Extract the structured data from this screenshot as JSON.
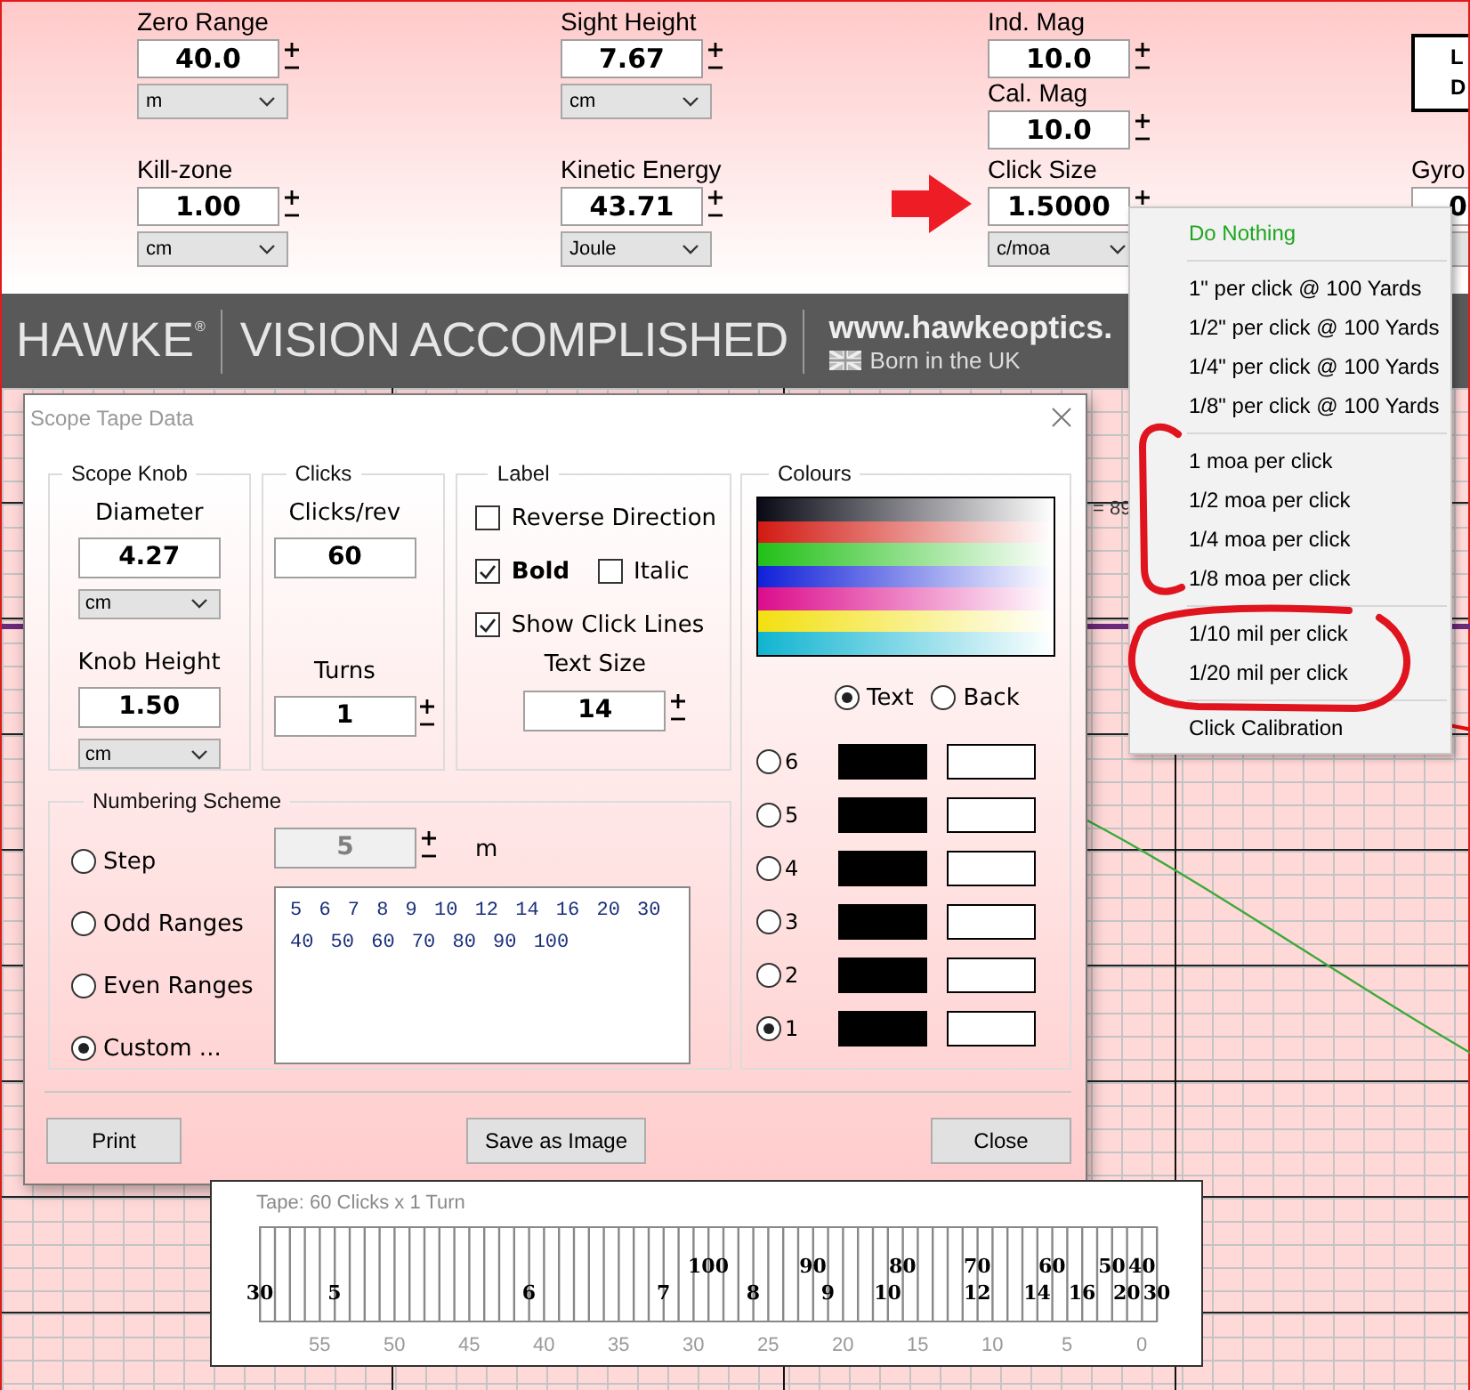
{
  "top_panel": {
    "columns": [
      {
        "fields": [
          {
            "label": "Zero Range",
            "value": "40.0",
            "unit": "m"
          },
          {
            "label": "Kill-zone",
            "value": "1.00",
            "unit": "cm"
          }
        ]
      },
      {
        "fields": [
          {
            "label": "Sight Height",
            "value": "7.67",
            "unit": "cm"
          },
          {
            "label": "Kinetic Energy",
            "value": "43.71",
            "unit": "Joule"
          }
        ]
      },
      {
        "fields": [
          {
            "label": "Ind. Mag",
            "value": "10.0"
          },
          {
            "label": "Cal. Mag",
            "value": "10.0"
          },
          {
            "label": "Click Size",
            "value": "1.5000",
            "unit": "c/moa"
          }
        ]
      }
    ],
    "edge_box": {
      "lines": [
        "L",
        "D"
      ]
    },
    "edge_field": {
      "label": "Gyro",
      "value": "0"
    }
  },
  "banner": {
    "logo": "HAWKE",
    "logo_mark": "®",
    "slogan": "VISION ACCOMPLISHED",
    "url": "www.hawkeoptics.",
    "origin": "Born in the UK"
  },
  "chart_label": "= 89",
  "click_size_menu": {
    "groups": [
      {
        "items": [
          {
            "label": "Do Nothing",
            "kind": "default"
          }
        ]
      },
      {
        "items": [
          {
            "label": "1\" per click @ 100 Yards",
            "kind": "option"
          },
          {
            "label": "1/2\" per click @ 100 Yards",
            "kind": "option"
          },
          {
            "label": "1/4\" per click @ 100 Yards",
            "kind": "option"
          },
          {
            "label": "1/8\" per click @ 100 Yards",
            "kind": "option"
          }
        ]
      },
      {
        "items": [
          {
            "label": "1 moa per click",
            "kind": "option"
          },
          {
            "label": "1/2 moa per click",
            "kind": "option"
          },
          {
            "label": "1/4 moa per click",
            "kind": "option"
          },
          {
            "label": "1/8 moa per click",
            "kind": "option"
          }
        ]
      },
      {
        "items": [
          {
            "label": "1/10 mil per click",
            "kind": "option"
          },
          {
            "label": "1/20 mil per click",
            "kind": "option"
          }
        ]
      },
      {
        "items": [
          {
            "label": "Click Calibration",
            "kind": "option"
          }
        ]
      }
    ]
  },
  "dialog": {
    "title": "Scope Tape Data",
    "scope_knob": {
      "title": "Scope Knob",
      "diameter": {
        "label": "Diameter",
        "value": "4.27",
        "unit": "cm"
      },
      "knob_height": {
        "label": "Knob Height",
        "value": "1.50",
        "unit": "cm"
      }
    },
    "clicks": {
      "title": "Clicks",
      "clicks_per_rev": {
        "label": "Clicks/rev",
        "value": "60"
      },
      "turns": {
        "label": "Turns",
        "value": "1"
      }
    },
    "label": {
      "title": "Label",
      "reverse_direction": {
        "label": "Reverse Direction",
        "checked": false
      },
      "bold": {
        "label": "Bold",
        "checked": true
      },
      "italic": {
        "label": "Italic",
        "checked": false
      },
      "show_click_lines": {
        "label": "Show Click Lines",
        "checked": true
      },
      "text_size": {
        "label": "Text Size",
        "value": "14"
      }
    },
    "numbering_scheme": {
      "title": "Numbering Scheme",
      "options": [
        {
          "label": "Step",
          "selected": false
        },
        {
          "label": "Odd Ranges",
          "selected": false
        },
        {
          "label": "Even Ranges",
          "selected": false
        },
        {
          "label": "Custom ...",
          "selected": true
        }
      ],
      "step": {
        "value": "5",
        "unit": "m",
        "disabled": true
      },
      "custom_ranges": "5 6 7 8 9 10 12 14 16 20 30 40 50 60 70 80 90 100"
    },
    "colours": {
      "title": "Colours",
      "targets": [
        {
          "label": "Text",
          "selected": true
        },
        {
          "label": "Back",
          "selected": false
        }
      ],
      "slots": [
        {
          "label": "6",
          "selected": false
        },
        {
          "label": "5",
          "selected": false
        },
        {
          "label": "4",
          "selected": false
        },
        {
          "label": "3",
          "selected": false
        },
        {
          "label": "2",
          "selected": false
        },
        {
          "label": "1",
          "selected": true
        }
      ]
    },
    "buttons": [
      "Print",
      "Save as Image",
      "Close"
    ]
  },
  "tape_window": {
    "title": "Tape: 60 Clicks x 1 Turn",
    "clicks": [
      {
        "line": true,
        "lower": "30"
      },
      {
        "line": true
      },
      {
        "line": true
      },
      {
        "line": true
      },
      {
        "line": true,
        "scale": "55"
      },
      {
        "line": true,
        "lower": "5"
      },
      {
        "line": true
      },
      {
        "line": true
      },
      {
        "line": true
      },
      {
        "line": true,
        "scale": "50"
      },
      {
        "line": true
      },
      {
        "line": true
      },
      {
        "line": true
      },
      {
        "line": true
      },
      {
        "line": true,
        "scale": "45"
      },
      {
        "line": true
      },
      {
        "line": true
      },
      {
        "line": true
      },
      {
        "line": true,
        "lower": "6"
      },
      {
        "line": true,
        "scale": "40"
      },
      {
        "line": true
      },
      {
        "line": true
      },
      {
        "line": true
      },
      {
        "line": true
      },
      {
        "line": true,
        "scale": "35"
      },
      {
        "line": true
      },
      {
        "line": true
      },
      {
        "line": true,
        "lower": "7"
      },
      {
        "line": true
      },
      {
        "line": true,
        "scale": "30"
      },
      {
        "line": true,
        "upper": "100"
      },
      {
        "line": true
      },
      {
        "line": true
      },
      {
        "line": true,
        "lower": "8"
      },
      {
        "line": true,
        "scale": "25"
      },
      {
        "line": true
      },
      {
        "line": true
      },
      {
        "line": true,
        "upper": "90"
      },
      {
        "line": true,
        "lower": "9"
      },
      {
        "line": true,
        "scale": "20"
      },
      {
        "line": true
      },
      {
        "line": true
      },
      {
        "line": true,
        "lower": "10"
      },
      {
        "line": true,
        "upper": "80"
      },
      {
        "line": true,
        "scale": "15"
      },
      {
        "line": true
      },
      {
        "line": true
      },
      {
        "line": true
      },
      {
        "line": true,
        "upper": "70",
        "lower": "12"
      },
      {
        "line": true,
        "scale": "10"
      },
      {
        "line": true
      },
      {
        "line": true
      },
      {
        "line": true,
        "lower": "14"
      },
      {
        "line": true,
        "upper": "60"
      },
      {
        "line": true,
        "scale": "5"
      },
      {
        "line": true,
        "lower": "16"
      },
      {
        "line": true
      },
      {
        "line": true,
        "upper": "50"
      },
      {
        "line": true,
        "lower": "20"
      },
      {
        "line": true,
        "upper": "40",
        "scale": "0"
      },
      {
        "line": true,
        "lower": "30"
      }
    ]
  }
}
